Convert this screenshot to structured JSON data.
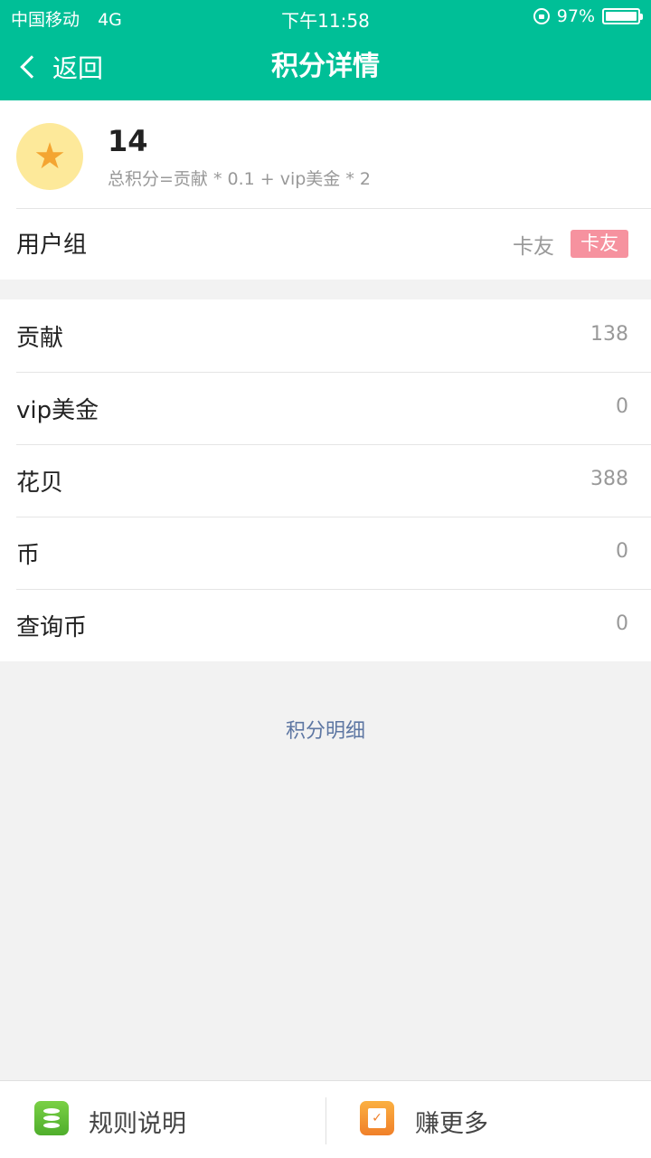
{
  "status_bar": {
    "carrier": "中国移动",
    "network": "4G",
    "time": "下午11:58",
    "battery": "97%"
  },
  "nav": {
    "back_label": "返回",
    "title": "积分详情"
  },
  "summary": {
    "score": "14",
    "formula": "总积分=贡献 * 0.1 + vip美金 * 2",
    "usergroup_label": "用户组",
    "usergroup_value": "卡友",
    "usergroup_badge": "卡友"
  },
  "rows": [
    {
      "label": "贡献",
      "value": "138"
    },
    {
      "label": "vip美金",
      "value": "0"
    },
    {
      "label": "花贝",
      "value": "388"
    },
    {
      "label": "币",
      "value": "0"
    },
    {
      "label": "查询币",
      "value": "0"
    }
  ],
  "detail_link": "积分明细",
  "bottom": {
    "rules_label": "规则说明",
    "earn_label": "赚更多"
  },
  "colors": {
    "primary": "#00bf97",
    "badge": "#f6929f",
    "link": "#5e77a3"
  }
}
